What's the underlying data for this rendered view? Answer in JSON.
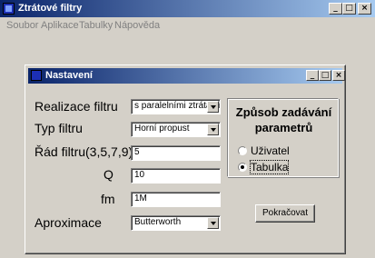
{
  "window": {
    "title": "Ztrátové filtry",
    "controls": {
      "minimize": "_",
      "maximize": "□",
      "close": "×"
    }
  },
  "menu": [
    "Soubor",
    "Aplikace",
    "Tabulky",
    "Nápověda"
  ],
  "dialog": {
    "title": "Nastavení",
    "controls": {
      "minimize": "_",
      "maximize": "□",
      "close": "×"
    },
    "fields": {
      "realizace": {
        "label": "Realizace filtru",
        "value": "s paralelními ztrátami"
      },
      "typ": {
        "label": "Typ filtru",
        "value": "Horní propust"
      },
      "rad": {
        "label": "Řád filtru(3,5,7,9)",
        "value": "5"
      },
      "q": {
        "label": "Q",
        "value": "10"
      },
      "fm": {
        "label": "fm",
        "value": "1M"
      },
      "aproximace": {
        "label": "Aproximace",
        "value": "Butterworth"
      }
    },
    "group": {
      "title_line1": "Způsob zadávání",
      "title_line2": "parametrů",
      "options": [
        {
          "label": "Uživatel",
          "checked": false
        },
        {
          "label": "Tabulka",
          "checked": true
        }
      ]
    },
    "continue_button": "Pokračovat"
  }
}
